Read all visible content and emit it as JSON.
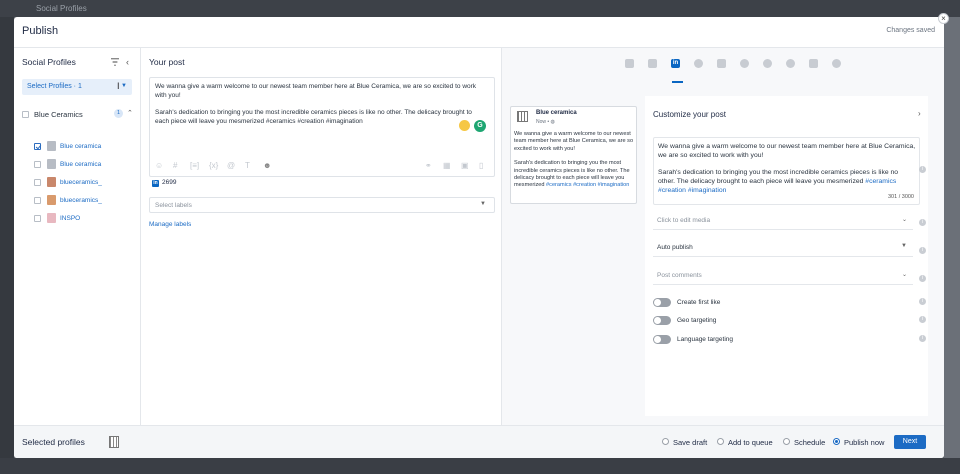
{
  "background": {
    "tab_title": "Social Profiles"
  },
  "modal": {
    "title": "Publish",
    "status": "Changes saved"
  },
  "profiles_panel": {
    "title": "Social Profiles",
    "select_label": "Select Profiles · 1",
    "group": {
      "name": "Blue Ceramics",
      "count": "1"
    },
    "items": [
      {
        "name": "Blue ceramica",
        "checked": true
      },
      {
        "name": "Blue ceramica",
        "checked": false
      },
      {
        "name": "blueceramics_",
        "checked": false
      },
      {
        "name": "blueceramics_",
        "checked": false
      },
      {
        "name": "INSPO",
        "checked": false
      }
    ]
  },
  "post": {
    "title": "Your post",
    "paragraph1": "We wanna give a warm welcome to our newest team member here at Blue Ceramica, we are so excited to work with you!",
    "paragraph2": "Sarah's dedication to bringing you the most incredible ceramics pieces is like no other. The delicacy brought to each piece will leave you mesmerized #ceramics #creation #imagination",
    "char_remaining": "2699",
    "labels_placeholder": "Select labels",
    "manage_labels": "Manage labels"
  },
  "preview": {
    "page_name": "Blue ceramica",
    "time": "Now •",
    "paragraph1": "We wanna give a warm welcome to our newest team member here at Blue Ceramica, we are so excited to work with you!",
    "paragraph2": "Sarah's dedication to bringing you the most incredible ceramics pieces is like no other. The delicacy brought to each piece will leave you mesmerized",
    "hashtags": "#ceramics #creation #imagination"
  },
  "customize": {
    "title": "Customize your post",
    "paragraph1": "We wanna give a warm welcome to our newest team member here at Blue Ceramica, we are so excited to work with you!",
    "paragraph2": "Sarah's dedication to bringing you the most incredible ceramics pieces is like no other. The delicacy brought to each piece will leave you mesmerized",
    "hashtags": "#ceramics #creation #imagination",
    "char_count": "301 / 3000",
    "media_placeholder": "Click to edit media",
    "publish_mode": "Auto publish",
    "comments_placeholder": "Post comments",
    "toggles": [
      {
        "label": "Create first like",
        "on": false
      },
      {
        "label": "Geo targeting",
        "on": false
      },
      {
        "label": "Language targeting",
        "on": false
      }
    ]
  },
  "footer": {
    "selected_profiles": "Selected profiles",
    "options": [
      "Save draft",
      "Add to queue",
      "Schedule",
      "Publish now"
    ],
    "selected_option": "Publish now",
    "next": "Next"
  },
  "colors": {
    "accent": "#1c6bc4",
    "linkedin": "#0a66c2",
    "hashtag": "#1c6bc4"
  }
}
